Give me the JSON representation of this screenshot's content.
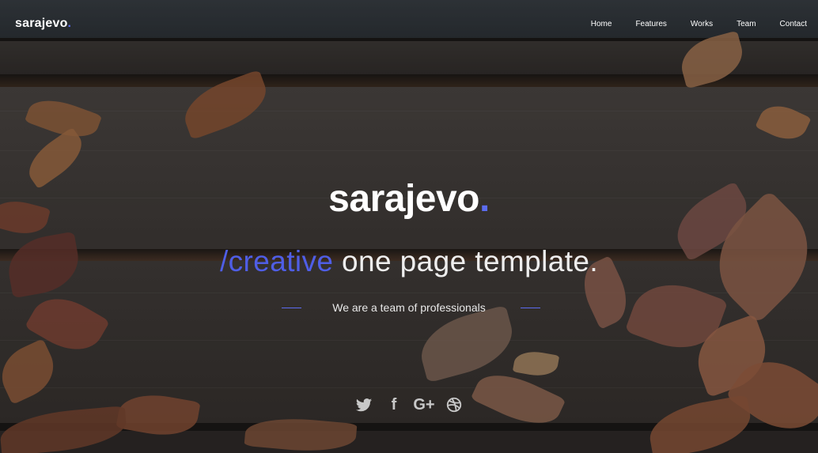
{
  "brand": {
    "name": "sarajevo",
    "dot": "."
  },
  "nav": {
    "items": [
      {
        "label": "Home"
      },
      {
        "label": "Features"
      },
      {
        "label": "Works"
      },
      {
        "label": "Team"
      },
      {
        "label": "Contact"
      }
    ]
  },
  "hero": {
    "title": "sarajevo",
    "title_dot": ".",
    "tagline_accent": "/creative",
    "tagline_rest": " one page template.",
    "subline": "We are a team of professionals"
  },
  "social": {
    "icons": [
      "twitter-icon",
      "facebook-icon",
      "google-plus-icon",
      "dribbble-icon"
    ],
    "facebook_glyph": "f",
    "google_plus_glyph": "G+"
  },
  "colors": {
    "accent": "#5b6cf0",
    "text": "#ffffff"
  }
}
